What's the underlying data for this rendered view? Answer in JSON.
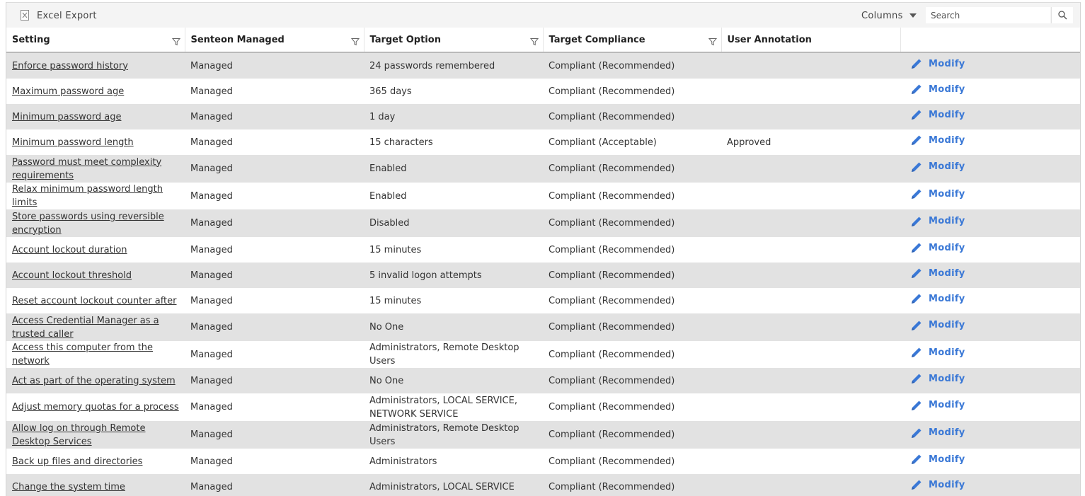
{
  "toolbar": {
    "excel_export_label": "Excel Export",
    "columns_label": "Columns",
    "search_placeholder": "Search"
  },
  "colors": {
    "accent": "#3a78d6",
    "row_shaded": "#e2e2e2",
    "toolbar_bg": "#f4f4f4"
  },
  "table": {
    "columns": [
      "Setting",
      "Senteon Managed",
      "Target Option",
      "Target Compliance",
      "User Annotation",
      ""
    ],
    "action_label": "Modify",
    "rows": [
      {
        "setting": "Enforce password history",
        "managed": "Managed",
        "target": "24 passwords remembered",
        "compliance": "Compliant (Recommended)",
        "annotation": ""
      },
      {
        "setting": "Maximum password age",
        "managed": "Managed",
        "target": "365 days",
        "compliance": "Compliant (Recommended)",
        "annotation": ""
      },
      {
        "setting": "Minimum password age",
        "managed": "Managed",
        "target": "1 day",
        "compliance": "Compliant (Recommended)",
        "annotation": ""
      },
      {
        "setting": "Minimum password length",
        "managed": "Managed",
        "target": "15 characters",
        "compliance": "Compliant (Acceptable)",
        "annotation": "Approved"
      },
      {
        "setting": "Password must meet complexity requirements",
        "managed": "Managed",
        "target": "Enabled",
        "compliance": "Compliant (Recommended)",
        "annotation": ""
      },
      {
        "setting": "Relax minimum password length limits",
        "managed": "Managed",
        "target": "Enabled",
        "compliance": "Compliant (Recommended)",
        "annotation": ""
      },
      {
        "setting": "Store passwords using reversible encryption",
        "managed": "Managed",
        "target": "Disabled",
        "compliance": "Compliant (Recommended)",
        "annotation": ""
      },
      {
        "setting": "Account lockout duration",
        "managed": "Managed",
        "target": "15 minutes",
        "compliance": "Compliant (Recommended)",
        "annotation": ""
      },
      {
        "setting": "Account lockout threshold",
        "managed": "Managed",
        "target": "5 invalid logon attempts",
        "compliance": "Compliant (Recommended)",
        "annotation": ""
      },
      {
        "setting": "Reset account lockout counter after",
        "managed": "Managed",
        "target": "15 minutes",
        "compliance": "Compliant (Recommended)",
        "annotation": ""
      },
      {
        "setting": "Access Credential Manager as a trusted caller",
        "managed": "Managed",
        "target": "No One",
        "compliance": "Compliant (Recommended)",
        "annotation": ""
      },
      {
        "setting": "Access this computer from the network",
        "managed": "Managed",
        "target": "Administrators, Remote Desktop Users",
        "compliance": "Compliant (Recommended)",
        "annotation": ""
      },
      {
        "setting": "Act as part of the operating system",
        "managed": "Managed",
        "target": "No One",
        "compliance": "Compliant (Recommended)",
        "annotation": ""
      },
      {
        "setting": "Adjust memory quotas for a process",
        "managed": "Managed",
        "target": "Administrators, LOCAL SERVICE, NETWORK SERVICE",
        "compliance": "Compliant (Recommended)",
        "annotation": ""
      },
      {
        "setting": "Allow log on through Remote Desktop Services",
        "managed": "Managed",
        "target": "Administrators, Remote Desktop Users",
        "compliance": "Compliant (Recommended)",
        "annotation": ""
      },
      {
        "setting": "Back up files and directories",
        "managed": "Managed",
        "target": "Administrators",
        "compliance": "Compliant (Recommended)",
        "annotation": ""
      },
      {
        "setting": "Change the system time",
        "managed": "Managed",
        "target": "Administrators, LOCAL SERVICE",
        "compliance": "Compliant (Recommended)",
        "annotation": ""
      }
    ]
  }
}
